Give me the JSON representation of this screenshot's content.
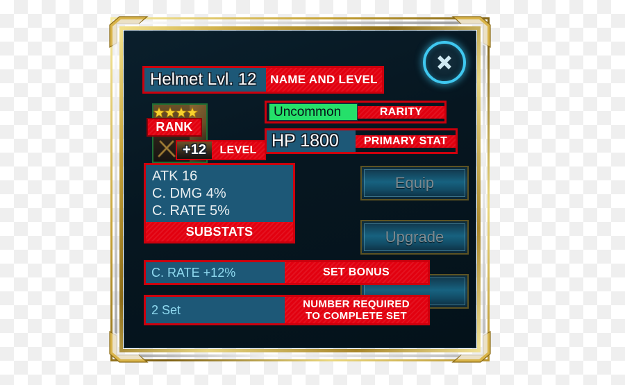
{
  "dialog": {
    "close_icon": "close-x-icon"
  },
  "title": {
    "value": "Helmet Lvl. 12",
    "annotation": "NAME AND LEVEL"
  },
  "rank": {
    "annotation": "RANK",
    "stars": 4,
    "star_icon": "star-icon"
  },
  "level": {
    "value": "+12",
    "annotation": "LEVEL"
  },
  "rarity": {
    "value": "Uncommon",
    "annotation": "RARITY",
    "color": "#25e06a"
  },
  "primary_stat": {
    "value": "HP 1800",
    "annotation": "PRIMARY STAT"
  },
  "substats": {
    "annotation": "SUBSTATS",
    "items": [
      "ATK 16",
      "C. DMG 4%",
      "C. RATE 5%"
    ]
  },
  "set_bonus": {
    "value": "C. RATE +12%",
    "annotation": "SET BONUS"
  },
  "set_count": {
    "value": "2 Set",
    "annotation_line1": "NUMBER REQUIRED",
    "annotation_line2": "TO COMPLETE SET"
  },
  "buttons": [
    {
      "label": "Equip"
    },
    {
      "label": "Upgrade"
    },
    {
      "label": ""
    }
  ],
  "colors": {
    "annotation_red": "#e2000f",
    "annotation_border": "#cc000d",
    "value_teal": "#1d5877",
    "panel_bg": "#061620",
    "accent_cyan": "#3fc8f0",
    "rarity_green": "#25e06a",
    "frame_gold": "#c8a53c"
  }
}
